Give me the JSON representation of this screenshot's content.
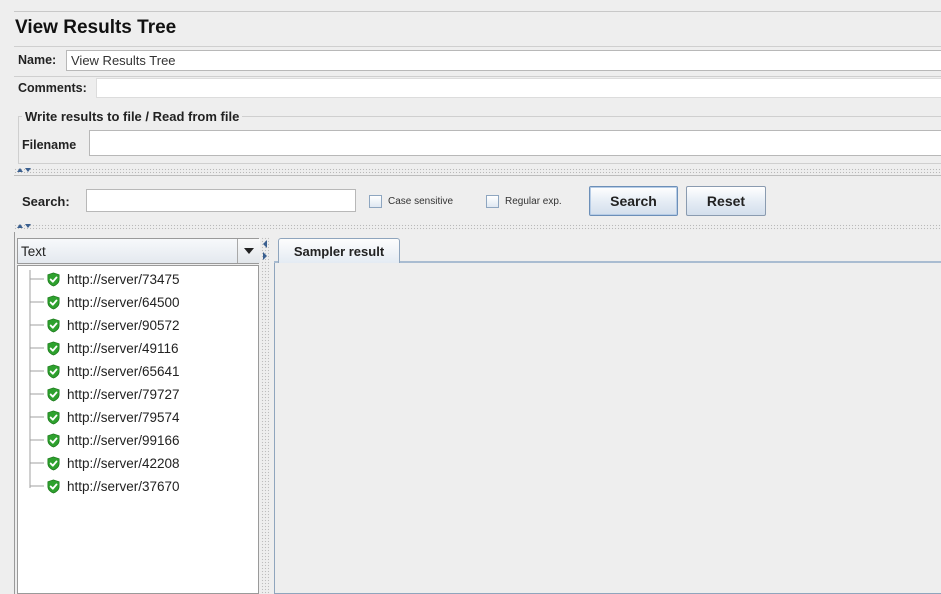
{
  "title": "View Results Tree",
  "name_field": {
    "label": "Name:",
    "value": "View Results Tree"
  },
  "comments_field": {
    "label": "Comments:",
    "value": ""
  },
  "file_group": {
    "title": "Write results to file / Read from file",
    "filename_label": "Filename",
    "filename_value": ""
  },
  "search_bar": {
    "label": "Search:",
    "value": "",
    "case_sensitive_label": "Case sensitive",
    "case_sensitive_checked": false,
    "regex_label": "Regular exp.",
    "regex_checked": false,
    "search_button": "Search",
    "reset_button": "Reset"
  },
  "tree": {
    "renderer_selected": "Text",
    "items": [
      {
        "label": "http://server/73475",
        "status": "success"
      },
      {
        "label": "http://server/64500",
        "status": "success"
      },
      {
        "label": "http://server/90572",
        "status": "success"
      },
      {
        "label": "http://server/49116",
        "status": "success"
      },
      {
        "label": "http://server/65641",
        "status": "success"
      },
      {
        "label": "http://server/79727",
        "status": "success"
      },
      {
        "label": "http://server/79574",
        "status": "success"
      },
      {
        "label": "http://server/99166",
        "status": "success"
      },
      {
        "label": "http://server/42208",
        "status": "success"
      },
      {
        "label": "http://server/37670",
        "status": "success"
      }
    ]
  },
  "result_tabs": [
    {
      "label": "Sampler result",
      "selected": true
    }
  ],
  "icons": {
    "success": "green-shield-check-icon",
    "dropdown": "triangle-down-icon",
    "splitter": "collapse-expand-arrows-icon"
  },
  "colors": {
    "success_green": "#2ea12e",
    "tab_border": "#8fa5bd"
  }
}
